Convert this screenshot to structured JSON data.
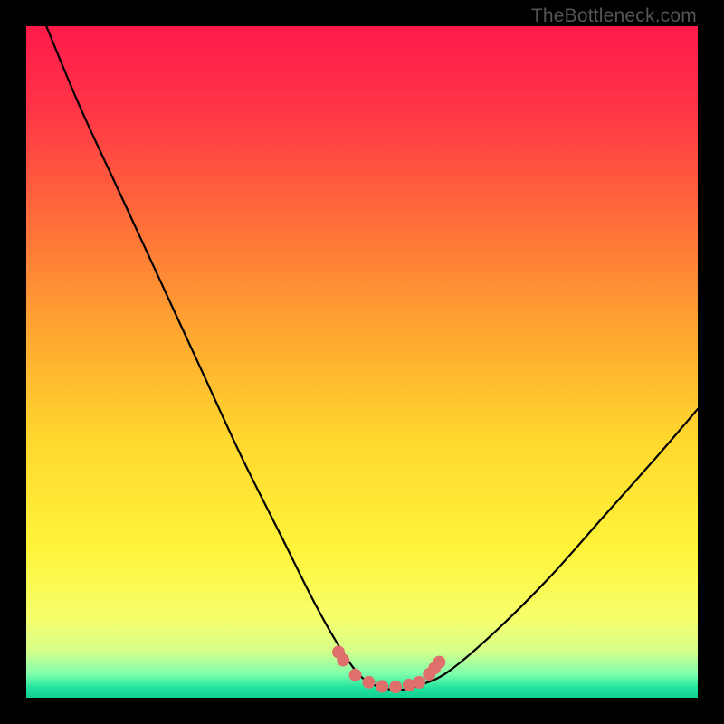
{
  "watermark": "TheBottleneck.com",
  "colors": {
    "black": "#000000",
    "curve": "#000000",
    "marker": "#df6f6b",
    "gradient_stops": [
      {
        "offset": 0.0,
        "color": "#ff1a4a"
      },
      {
        "offset": 0.12,
        "color": "#ff3447"
      },
      {
        "offset": 0.28,
        "color": "#ff6a3a"
      },
      {
        "offset": 0.45,
        "color": "#ffa531"
      },
      {
        "offset": 0.62,
        "color": "#ffd92e"
      },
      {
        "offset": 0.78,
        "color": "#fff43a"
      },
      {
        "offset": 0.88,
        "color": "#f7ff6a"
      },
      {
        "offset": 0.93,
        "color": "#d7ff8a"
      },
      {
        "offset": 0.965,
        "color": "#7dffad"
      },
      {
        "offset": 0.985,
        "color": "#22e39e"
      },
      {
        "offset": 1.0,
        "color": "#10cf91"
      }
    ]
  },
  "chart_data": {
    "type": "line",
    "title": "",
    "xlabel": "",
    "ylabel": "",
    "xlim": [
      0,
      100
    ],
    "ylim": [
      0,
      100
    ],
    "legend": false,
    "grid": false,
    "series": [
      {
        "name": "bottleneck-curve",
        "x": [
          3,
          8,
          14,
          20,
          26,
          32,
          38,
          43,
          47,
          50,
          53,
          56,
          59,
          63,
          70,
          78,
          86,
          94,
          100
        ],
        "y": [
          100,
          88,
          75,
          62,
          49,
          36,
          24,
          14,
          7,
          3,
          1.5,
          1.2,
          2,
          4,
          10,
          18,
          27,
          36,
          43
        ]
      }
    ],
    "markers": {
      "name": "highlight-points",
      "x": [
        46.5,
        47.2,
        49,
        51,
        53,
        55,
        57,
        58.5,
        60,
        60.8,
        61.5
      ],
      "y": [
        6.8,
        5.6,
        3.4,
        2.3,
        1.7,
        1.6,
        1.9,
        2.3,
        3.5,
        4.4,
        5.3
      ]
    }
  }
}
